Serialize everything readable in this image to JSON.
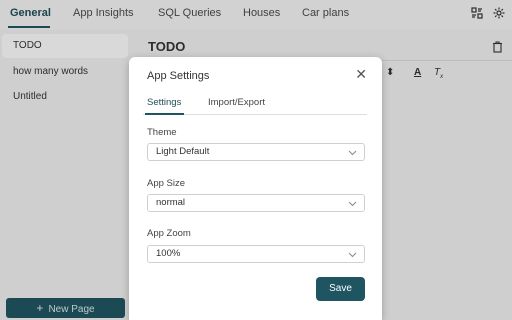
{
  "top_tabs": [
    "General",
    "App Insights",
    "SQL Queries",
    "Houses",
    "Car plans"
  ],
  "sidebar": {
    "items": [
      "TODO",
      "how many words",
      "Untitled"
    ],
    "new_page": "New Page"
  },
  "editor": {
    "title": "TODO"
  },
  "dialog": {
    "title": "App Settings",
    "tabs": [
      "Settings",
      "Import/Export"
    ],
    "fields": [
      {
        "label": "Theme",
        "value": "Light Default"
      },
      {
        "label": "App Size",
        "value": "normal"
      },
      {
        "label": "App Zoom",
        "value": "100%"
      }
    ],
    "save": "Save"
  },
  "colors": {
    "accent": "#1f5561"
  }
}
